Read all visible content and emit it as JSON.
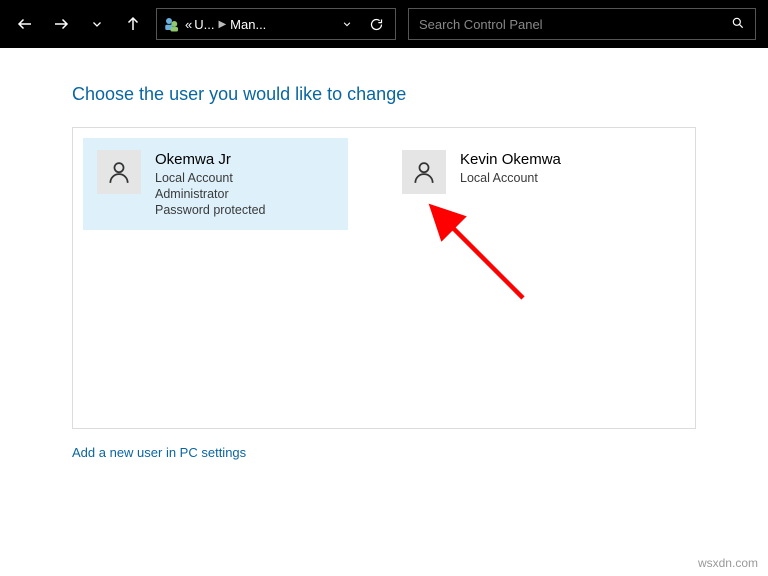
{
  "nav": {
    "breadcrumb": {
      "chevrons": "«",
      "seg1": "U...",
      "seg2": "Man..."
    }
  },
  "search": {
    "placeholder": "Search Control Panel"
  },
  "heading": "Choose the user you would like to change",
  "users": [
    {
      "name": "Okemwa Jr",
      "line1": "Local Account",
      "line2": "Administrator",
      "line3": "Password protected",
      "selected": true
    },
    {
      "name": "Kevin Okemwa",
      "line1": "Local Account",
      "line2": "",
      "line3": "",
      "selected": false
    }
  ],
  "add_link": "Add a new user in PC settings",
  "watermark": "wsxdn.com"
}
